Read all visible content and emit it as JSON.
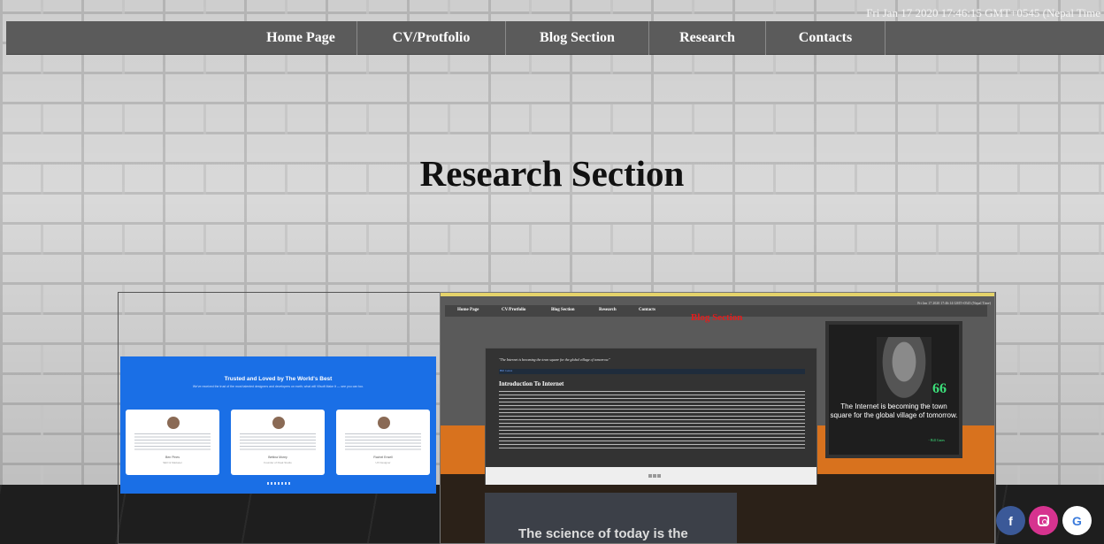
{
  "datetime": "Fri Jan 17 2020 17:46:15 GMT+0545 (Nepal Time",
  "nav": {
    "items": [
      {
        "label": "Home Page"
      },
      {
        "label": "CV/Protfolio"
      },
      {
        "label": "Blog Section"
      },
      {
        "label": "Research"
      },
      {
        "label": "Contacts"
      }
    ]
  },
  "hero": {
    "title": "Research Section"
  },
  "gallery": {
    "slide_left": {
      "title": "Trusted and Loved by The World's Best",
      "subtitle": "We've received the trust of the most talented designers and developers on earth; what will Vlisoft Make It — see you can too.",
      "testimonials": [
        {
          "name": "Ben Pines",
          "role": "SEO & Marketer"
        },
        {
          "name": "Bettina Morey",
          "role": "Founder of Peak Studio"
        },
        {
          "name": "Rachel Ensell",
          "role": "UX Designer"
        }
      ]
    },
    "slide_main": {
      "mini_date": "Fri Jan 17 2020 17:46:14 GMT+0545 (Nepal Time)",
      "mini_nav": [
        "Home Page",
        "CV/Protfolio",
        "Blog Section",
        "Research",
        "Contacts"
      ],
      "mini_title": "Blog Section",
      "article": {
        "quote": "\"The Internet is becoming the town square for the global village of tomorrow.\"",
        "byline": "Bill Gates",
        "heading": "Introduction To Internet"
      },
      "photo": {
        "quote_mark": "66",
        "text": "The Internet is becoming the town square for the global village of tomorrow.",
        "by": "- Bill Gates"
      },
      "bottom_text": "The science of today is the"
    }
  },
  "social": {
    "facebook": "f",
    "google": "G"
  }
}
